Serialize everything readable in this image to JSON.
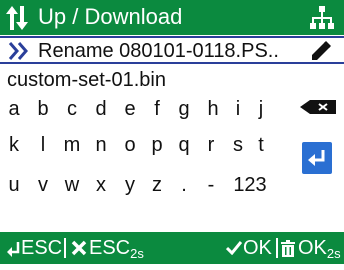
{
  "header": {
    "title": "Up / Download",
    "title_icon": "up-down-arrows-icon",
    "network_icon": "network-tree-icon",
    "bg_color": "#0b8a3f"
  },
  "rename": {
    "text": "Rename 080101-0118.PS..",
    "nav_icon": "double-chevron-right-icon",
    "edit_icon": "pencil-icon"
  },
  "input": {
    "value": "custom-set-01.bin"
  },
  "keyboard": {
    "row1": [
      "a",
      "b",
      "c",
      "d",
      "e",
      "f",
      "g",
      "h",
      "i",
      "j"
    ],
    "row2": [
      "k",
      "l",
      "m",
      "n",
      "o",
      "p",
      "q",
      "r",
      "s",
      "t"
    ],
    "row3": [
      "u",
      "v",
      "w",
      "x",
      "y",
      "z",
      ".",
      "-",
      "123"
    ],
    "backspace_icon": "backspace-icon",
    "enter_icon": "enter-icon",
    "enter_color": "#2a6fd2"
  },
  "footer": {
    "esc": "ESC",
    "esc2": "ESC",
    "esc2_sub": "2s",
    "ok": "OK",
    "ok2": "OK",
    "ok2_sub": "2s",
    "back_icon": "return-arrow-icon",
    "cancel_icon": "x-icon",
    "confirm_icon": "checkmark-icon",
    "delete_icon": "trash-icon"
  }
}
